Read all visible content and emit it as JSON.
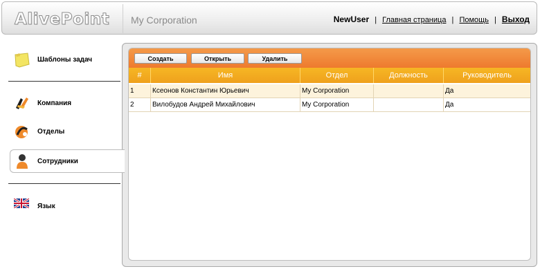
{
  "header": {
    "logo_text": "AlivePoint",
    "corporation": "My Corporation",
    "username": "NewUser",
    "links": {
      "home": "Главная страница",
      "help": "Помощь",
      "exit": "Выход"
    },
    "separator": "|"
  },
  "sidebar": {
    "templates": "Шаблоны задач",
    "company": "Компания",
    "departments": "Отделы",
    "employees": "Сотрудники",
    "language": "Язык"
  },
  "toolbar": {
    "create": "Создать",
    "open": "Открыть",
    "delete": "Удалить"
  },
  "table": {
    "columns": [
      "#",
      "Имя",
      "Отдел",
      "Должность",
      "Руководитель"
    ],
    "rows": [
      [
        "1",
        "Ксеонов Константин Юрьевич",
        "My Corporation",
        "",
        "Да"
      ],
      [
        "2",
        "Вилобудов Андрей Михайлович",
        "My Corporation",
        "",
        "Да"
      ]
    ]
  },
  "colors": {
    "accent_orange": "#ee7a2e",
    "header_yellow": "#f2a51f",
    "row_highlight": "#fdf3dc"
  }
}
